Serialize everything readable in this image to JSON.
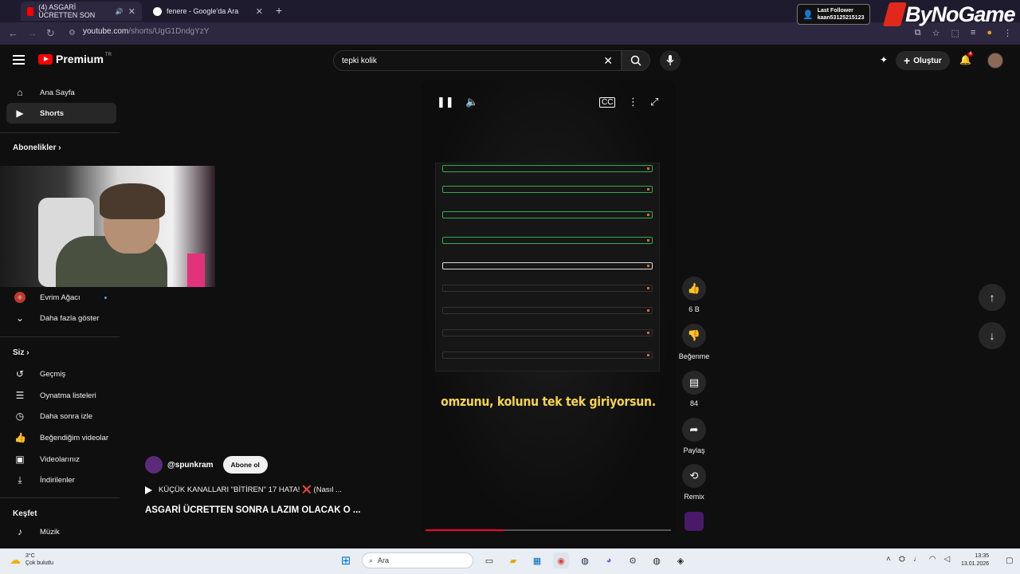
{
  "browser": {
    "tabs": [
      {
        "title": "(4) ASGARİ ÜCRETTEN SON",
        "active": true
      },
      {
        "title": "fenere - Google'da Ara",
        "active": false
      }
    ],
    "url_domain": "youtube.com",
    "url_path": "/shorts/UgG1DndgYzY"
  },
  "overlay": {
    "follower_label": "Last Follower",
    "follower_name": "kaan53125215123",
    "brand": "ByNoGame"
  },
  "header": {
    "logo": "Premium",
    "logo_region": "TR",
    "search_value": "tepki kolik",
    "create_label": "Oluştur",
    "notifications": "4"
  },
  "sidebar": {
    "home": "Ana Sayfa",
    "shorts": "Shorts",
    "subscriptions_title": "Abonelikler",
    "subscription_channel": "Evrim Ağacı",
    "show_more": "Daha fazla göster",
    "you_title": "Siz",
    "history": "Geçmiş",
    "playlists": "Oynatma listeleri",
    "watch_later": "Daha sonra izle",
    "liked": "Beğendiğim videolar",
    "your_videos": "Videolarınız",
    "downloads": "İndirilenler",
    "explore_title": "Keşfet",
    "music": "Müzik"
  },
  "player": {
    "caption": "omzunu, kolunu tek tek giriyorsun.",
    "progress": 0.32
  },
  "actions": {
    "likes": "6 B",
    "dislike_label": "Beğenme",
    "comments": "84",
    "share_label": "Paylaş",
    "remix_label": "Remix"
  },
  "video": {
    "channel": "@spunkram",
    "subscribe_label": "Abone ol",
    "playlist_title": "KÜÇÜK KANALLARI \"BİTİREN\" 17 HATA! ❌ (Nasıl ...",
    "title": "ASGARİ ÜCRETTEN SONRA LAZIM OLACAK O ..."
  },
  "taskbar": {
    "temperature": "3°C",
    "weather": "Çok bulutlu",
    "search_placeholder": "Ara",
    "time": "13:35",
    "date": "13.01.2026"
  }
}
